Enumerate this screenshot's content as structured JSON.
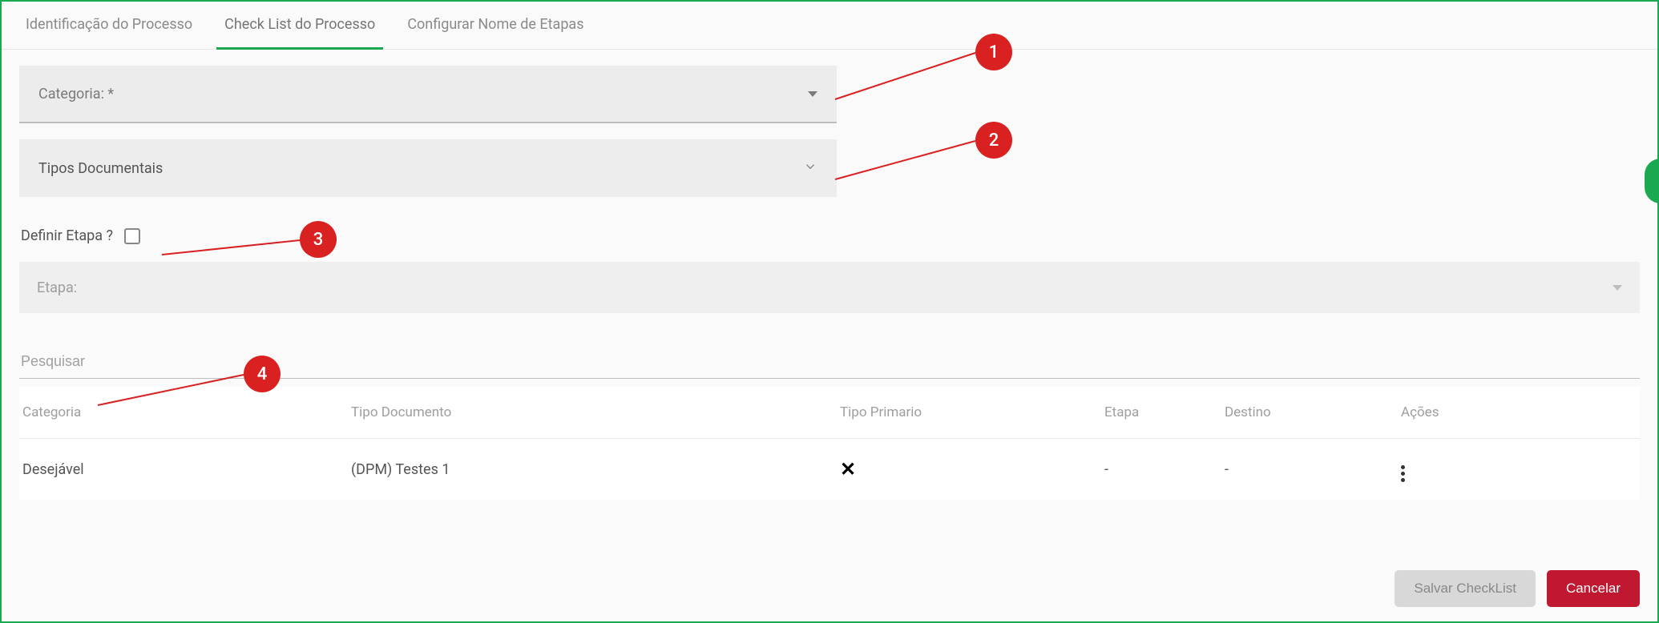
{
  "tabs": {
    "identificacao": "Identificação do Processo",
    "checklist": "Check List do Processo",
    "configurar": "Configurar Nome de Etapas"
  },
  "fields": {
    "categoria_label": "Categoria: *",
    "tipos_label": "Tipos Documentais",
    "definir_etapa_label": "Definir Etapa ?",
    "etapa_label": "Etapa:",
    "pesquisar_placeholder": "Pesquisar"
  },
  "table": {
    "headers": {
      "categoria": "Categoria",
      "tipo_documento": "Tipo Documento",
      "tipo_primario": "Tipo Primario",
      "etapa": "Etapa",
      "destino": "Destino",
      "acoes": "Ações"
    },
    "rows": [
      {
        "categoria": "Desejável",
        "tipo_documento": "(DPM) Testes 1",
        "tipo_primario_icon": "x",
        "etapa": "-",
        "destino": "-"
      }
    ]
  },
  "buttons": {
    "salvar": "Salvar CheckList",
    "cancelar": "Cancelar"
  },
  "annotations": {
    "n1": "1",
    "n2": "2",
    "n3": "3",
    "n4": "4"
  }
}
